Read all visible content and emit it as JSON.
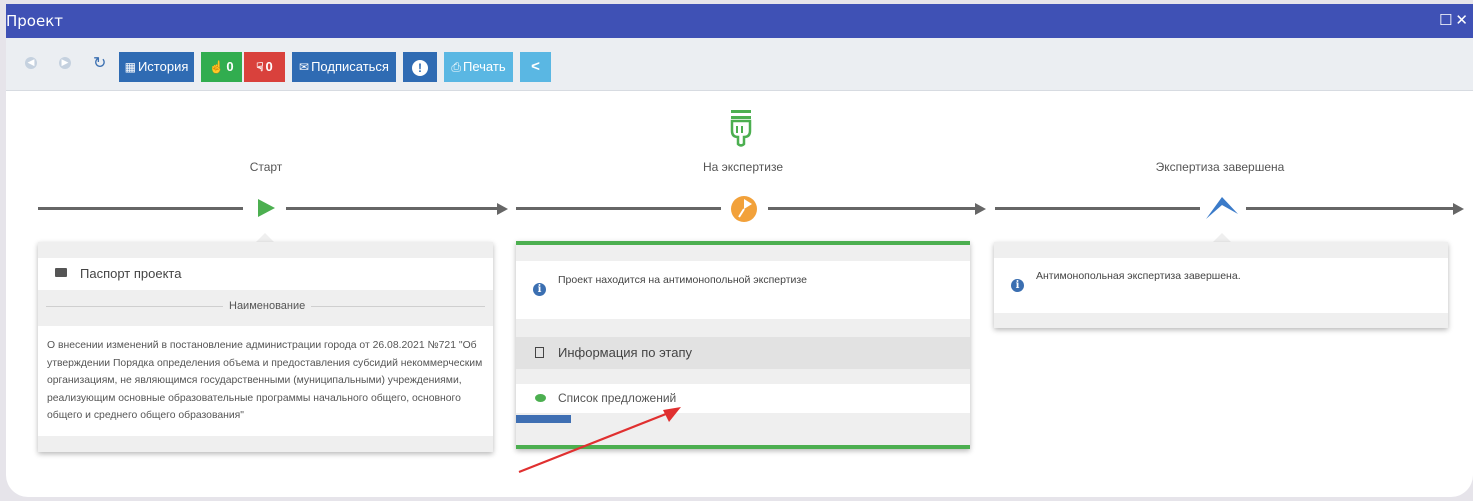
{
  "window": {
    "title": "Проект",
    "controls": "☐✕"
  },
  "toolbar": {
    "back_icon": "arrow-left-circle",
    "forward_icon": "arrow-right-circle",
    "refresh_icon": "refresh",
    "history_label": "История",
    "like_count": "0",
    "dislike_count": "0",
    "subscribe_label": "Подписаться",
    "alert_label": "!",
    "print_label": "Печать",
    "share_label": "share"
  },
  "colors": {
    "titlebar": "#3f51b5",
    "primary_btn": "#2f6bb3",
    "like_btn": "#31ad4f",
    "dislike_btn": "#d9413c",
    "print_btn": "#5ab7e3",
    "green_accent": "#4caf50",
    "orange_accent": "#f2a13a"
  },
  "stages": {
    "start": {
      "label": "Старт",
      "icon": "play-triangle"
    },
    "expertise": {
      "label": "На экспертизе",
      "icon": "pie-chart-orange",
      "top_icon": "hand-pointing-down"
    },
    "finished": {
      "label": "Экспертиза завершена",
      "icon": "arrow-up-chevron"
    }
  },
  "passport_card": {
    "title": "Паспорт проекта",
    "section": "Наименование",
    "description": "О внесении изменений в постановление администрации города от 26.08.2021 №721 \"Об утверждении Порядка определения объема и предоставления субсидий некоммерческим организациям, не являющимся государственными (муниципальными) учреждениями, реализующим основные образовательные программы начального общего, основного общего и среднего общего образования\""
  },
  "expertise_card": {
    "status_text": "Проект находится на антимонопольной экспертизе",
    "stage_info_label": "Информация по этапу",
    "proposals_label": "Список предложений"
  },
  "finished_card": {
    "status_text": "Антимонопольная экспертиза завершена."
  }
}
